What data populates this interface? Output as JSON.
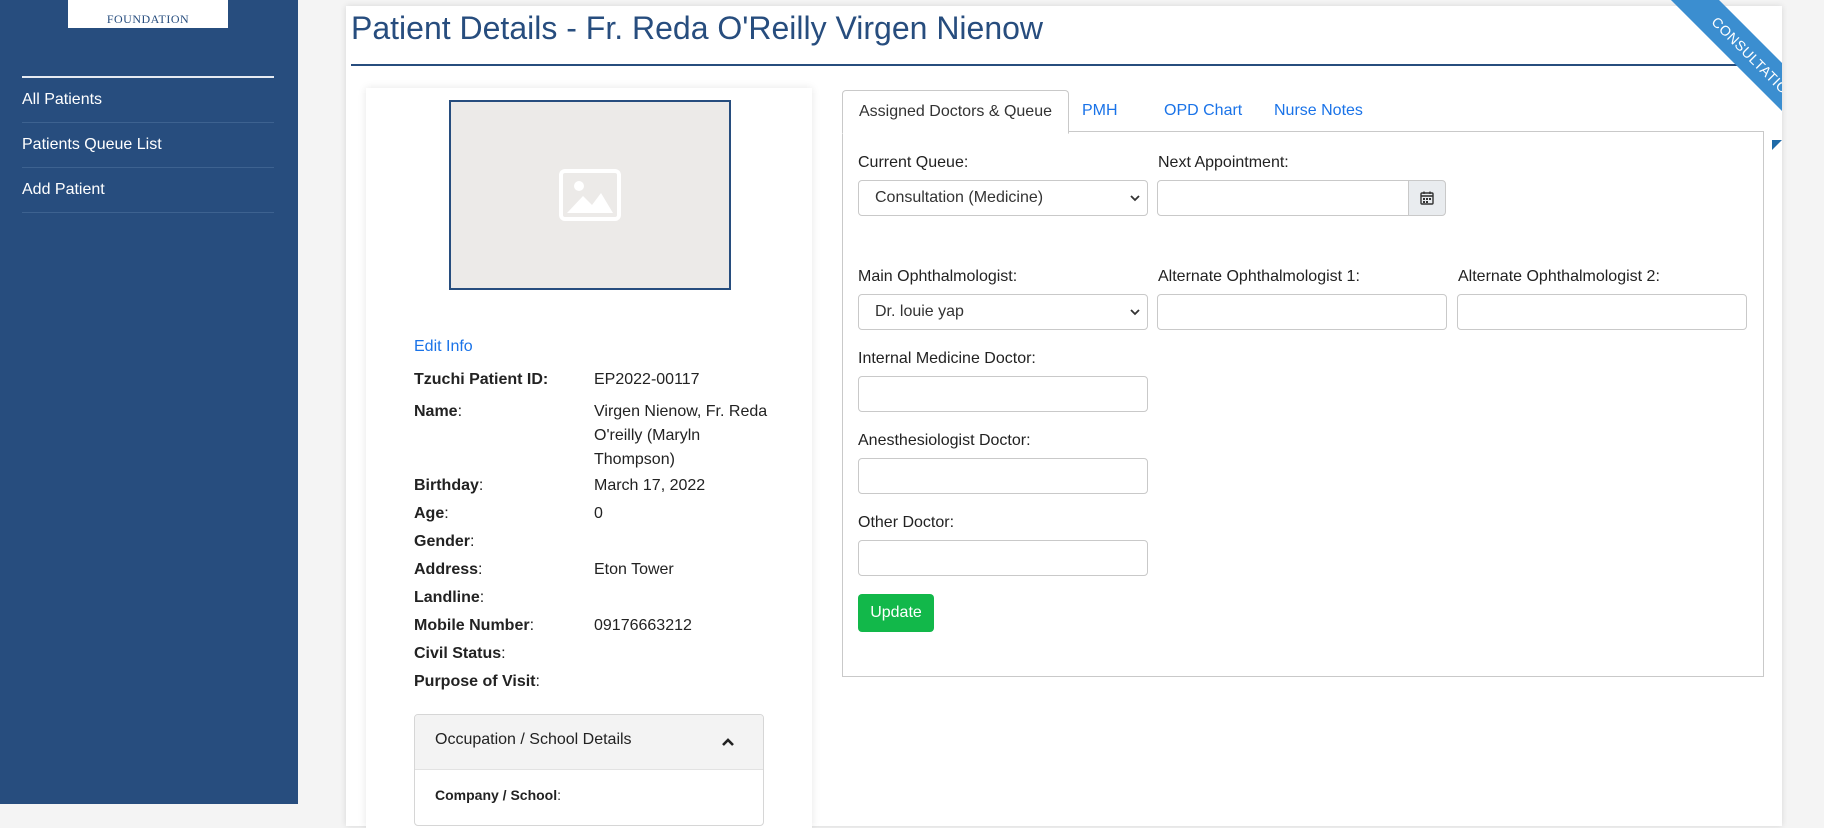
{
  "brand": {
    "logo_text": "FOUNDATION"
  },
  "sidebar": {
    "items": [
      {
        "label": "All Patients"
      },
      {
        "label": "Patients Queue List"
      },
      {
        "label": "Add Patient"
      }
    ]
  },
  "page": {
    "title": "Patient Details - Fr. Reda O'Reilly Virgen Nienow",
    "ribbon": "CONSULTATION"
  },
  "patient": {
    "edit_link": "Edit Info",
    "fields": [
      {
        "label": "Tzuchi Patient ID:",
        "colon": "",
        "value": "EP2022-00117"
      },
      {
        "label": "Name",
        "colon": ":",
        "value": "Virgen Nienow, Fr. Reda O'reilly (Maryln Thompson)"
      },
      {
        "label": "Birthday",
        "colon": ":",
        "value": "March 17, 2022"
      },
      {
        "label": "Age",
        "colon": ":",
        "value": "0"
      },
      {
        "label": "Gender",
        "colon": ":",
        "value": ""
      },
      {
        "label": "Address",
        "colon": ":",
        "value": "Eton Tower"
      },
      {
        "label": "Landline",
        "colon": ":",
        "value": ""
      },
      {
        "label": "Mobile Number",
        "colon": ":",
        "value": "09176663212"
      },
      {
        "label": "Civil Status",
        "colon": ":",
        "value": ""
      },
      {
        "label": "Purpose of Visit",
        "colon": ":",
        "value": ""
      }
    ],
    "occupation": {
      "title": "Occupation / School Details",
      "field_label": "Company / School",
      "colon": ":"
    }
  },
  "tabs": [
    {
      "label": "Assigned Doctors & Queue",
      "active": true
    },
    {
      "label": "PMH",
      "active": false
    },
    {
      "label": "OPD Chart",
      "active": false
    },
    {
      "label": "Nurse Notes",
      "active": false
    }
  ],
  "form": {
    "current_queue": {
      "label": "Current Queue:",
      "value": "Consultation (Medicine)"
    },
    "next_appointment": {
      "label": "Next Appointment:",
      "value": ""
    },
    "main_ophthalmologist": {
      "label": "Main Ophthalmologist:",
      "value": "Dr. louie yap"
    },
    "alt_ophthalmologist_1": {
      "label": "Alternate Ophthalmologist 1:",
      "value": ""
    },
    "alt_ophthalmologist_2": {
      "label": "Alternate Ophthalmologist 2:",
      "value": ""
    },
    "internal_medicine": {
      "label": "Internal Medicine Doctor:",
      "value": ""
    },
    "anesthesiologist": {
      "label": "Anesthesiologist Doctor:",
      "value": ""
    },
    "other_doctor": {
      "label": "Other Doctor:",
      "value": ""
    },
    "update_label": "Update"
  },
  "colors": {
    "sidebar": "#274d7e",
    "link": "#1a73e8",
    "success": "#12b84a",
    "ribbon": "#3b8ed0"
  },
  "icons": {
    "photo": "image-placeholder-icon",
    "calendar": "calendar-icon",
    "chevron": "chevron-up-icon"
  }
}
